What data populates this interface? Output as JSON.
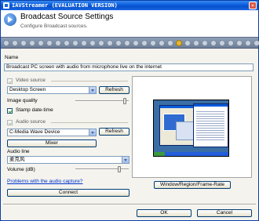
{
  "window": {
    "title": "IAVStreamer (EVALUATION VERSION)"
  },
  "header": {
    "title": "Broadcast Source Settings",
    "subtitle": "Configure Broadcast sources."
  },
  "form": {
    "name_label": "Name",
    "name_value": "Broadcast PC screen with audio from microphone live on the internet",
    "video_source_label": "Video source",
    "video_source_value": "Desktop Screen",
    "refresh_label": "Refresh",
    "image_quality_label": "Image quality",
    "image_quality_level": 0.95,
    "stamp_label": "Stamp date-time",
    "audio_source_label": "Audio source",
    "audio_source_value": "C-Media Wave Device",
    "refresh2_label": "Refresh",
    "mixer_label": "Mixer",
    "audio_line_label": "Audio line",
    "audio_line_value": "麦克风",
    "volume_label": "Volume (dB)",
    "volume_level": 0.85,
    "problems_link": "Problems with the audio capture?",
    "connect_label": "Connect"
  },
  "preview": {
    "region_button": "Window/Region/Frame-Rate"
  },
  "footer": {
    "ok_label": "OK",
    "cancel_label": "Cancel"
  },
  "icons": {
    "app": "app-icon",
    "logo": "broadcast-logo-icon",
    "close": "close-icon"
  },
  "colors": {
    "titlebar": "#0a5ddc",
    "link": "#0033cc",
    "stepbar": "#7c8ea6"
  }
}
